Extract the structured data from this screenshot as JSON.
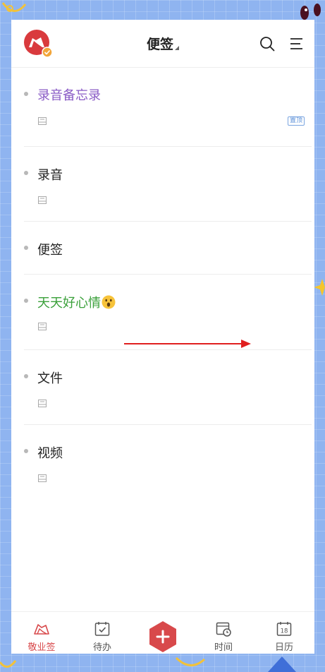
{
  "header": {
    "title": "便签",
    "logo_icon": "red-folder-logo-icon",
    "search_icon": "search-icon",
    "menu_icon": "menu-icon"
  },
  "notes": [
    {
      "title": "录音备忘录",
      "color": "#8a5cc6",
      "pin_label": "置顶",
      "has_attachment": true
    },
    {
      "title": "录音",
      "color": "#222222",
      "has_attachment": true
    },
    {
      "title": "便签",
      "color": "#222222",
      "has_attachment": false
    },
    {
      "title": "天天好心情",
      "color": "#3aa03a",
      "emoji": "surprised-face-emoji",
      "has_attachment": true
    },
    {
      "title": "文件",
      "color": "#222222",
      "has_attachment": true
    },
    {
      "title": "视频",
      "color": "#222222",
      "has_attachment": true
    }
  ],
  "tabbar": {
    "items": [
      {
        "label": "敬业签",
        "icon": "note-folder-icon",
        "active": true
      },
      {
        "label": "待办",
        "icon": "calendar-check-icon",
        "active": false
      },
      {
        "label": "",
        "icon": "add-icon",
        "active": false
      },
      {
        "label": "时间",
        "icon": "clock-calendar-icon",
        "active": false
      },
      {
        "label": "日历",
        "icon": "calendar-18-icon",
        "active": false,
        "badge": "18"
      }
    ]
  },
  "colors": {
    "accent": "#d8494b",
    "background": "#8fb4f0",
    "annotation_arrow": "#e01f1f"
  }
}
